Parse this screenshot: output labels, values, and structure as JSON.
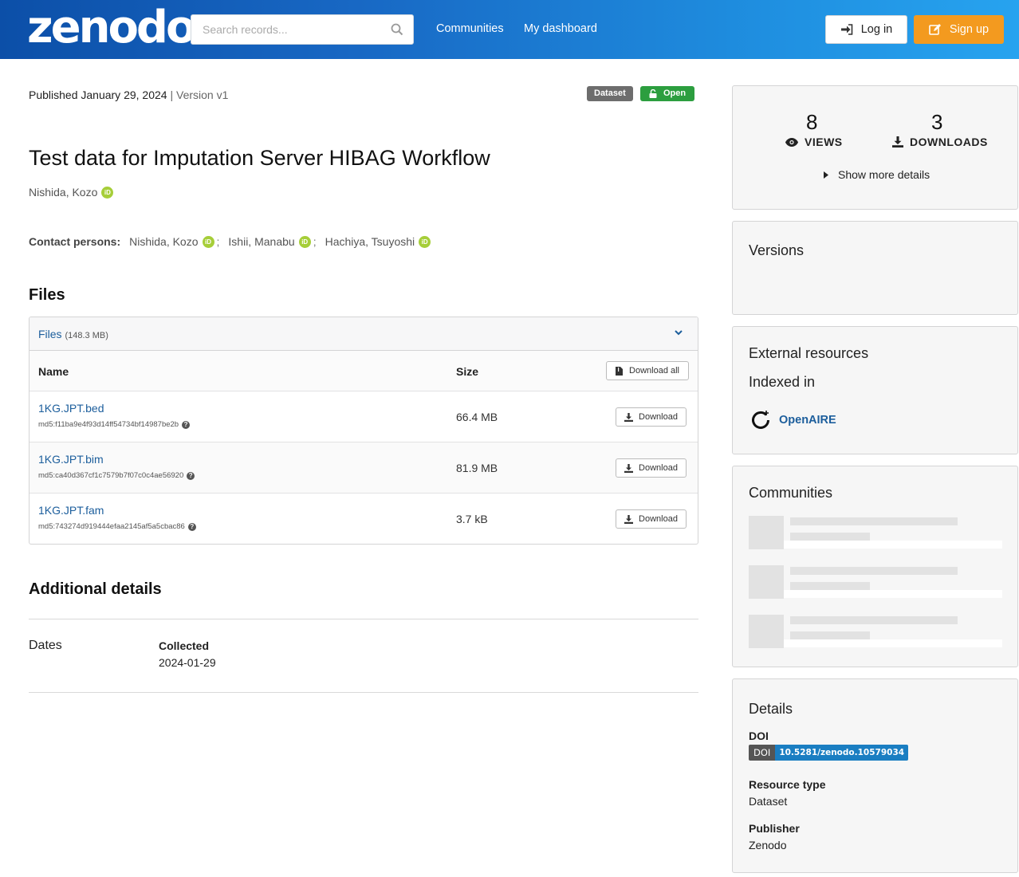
{
  "header": {
    "logo": "zenodo",
    "search_placeholder": "Search records...",
    "nav": [
      "Communities",
      "My dashboard"
    ],
    "login_label": "Log in",
    "signup_label": "Sign up"
  },
  "record": {
    "published": "Published January 29, 2024",
    "separator": "|",
    "version": "Version v1",
    "badge_type": "Dataset",
    "badge_access": "Open",
    "title": "Test data for Imputation Server HIBAG Workflow",
    "creator": "Nishida, Kozo",
    "contacts_label": "Contact persons:",
    "contacts": [
      "Nishida, Kozo",
      "Ishii, Manabu",
      "Hachiya, Tsuyoshi"
    ]
  },
  "files": {
    "heading": "Files",
    "panel_title": "Files",
    "panel_size": "(148.3 MB)",
    "col_name": "Name",
    "col_size": "Size",
    "download_all": "Download all",
    "download_label": "Download",
    "items": [
      {
        "name": "1KG.JPT.bed",
        "md5": "md5:f11ba9e4f93d14ff54734bf14987be2b",
        "size": "66.4 MB"
      },
      {
        "name": "1KG.JPT.bim",
        "md5": "md5:ca40d367cf1c7579b7f07c0c4ae56920",
        "size": "81.9 MB"
      },
      {
        "name": "1KG.JPT.fam",
        "md5": "md5:743274d919444efaa2145af5a5cbac86",
        "size": "3.7 kB"
      }
    ]
  },
  "additional": {
    "heading": "Additional details",
    "dates_label": "Dates",
    "collected_label": "Collected",
    "collected_value": "2024-01-29"
  },
  "sidebar": {
    "views_count": "8",
    "views_label": "VIEWS",
    "downloads_count": "3",
    "downloads_label": "DOWNLOADS",
    "show_more": "Show more details",
    "versions_heading": "Versions",
    "external_heading": "External resources",
    "indexed_in": "Indexed in",
    "openaire": "OpenAIRE",
    "communities_heading": "Communities",
    "details_heading": "Details",
    "doi_label": "DOI",
    "doi_badge_left": "DOI",
    "doi_value": "10.5281/zenodo.10579034",
    "resource_type_label": "Resource type",
    "resource_type_value": "Dataset",
    "publisher_label": "Publisher",
    "publisher_value": "Zenodo"
  },
  "colors": {
    "header_start": "#0c4fa8",
    "header_end": "#27a3ef",
    "signup": "#f39a1f",
    "open_badge": "#2c9e3f",
    "link": "#1c5e9c",
    "orcid": "#a6ce39",
    "doi_blue": "#1a7ec2"
  }
}
